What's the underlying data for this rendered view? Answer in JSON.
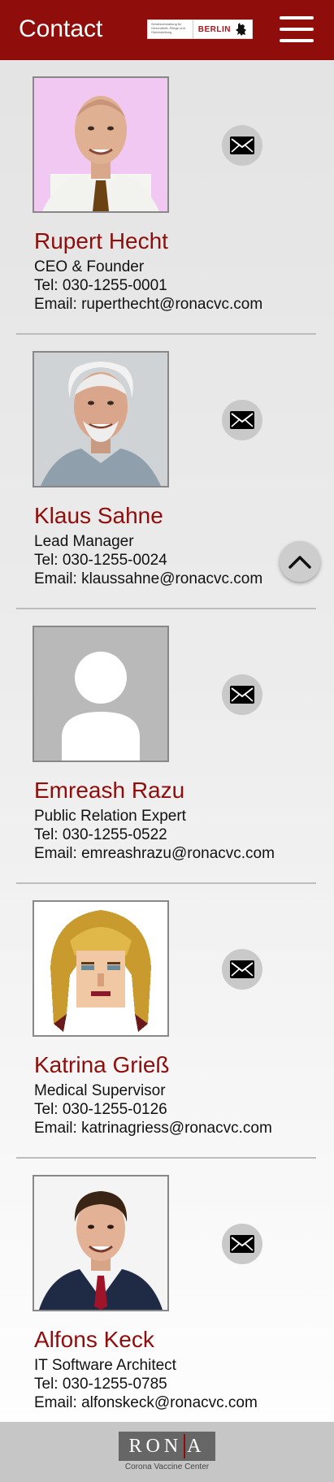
{
  "header": {
    "title": "Contact",
    "logo_small": "Senatsverwaltung für Gesundheit, Pflege und Gleichstellung",
    "logo_word": "BERLIN",
    "bg_color": "#8f0d0a"
  },
  "contacts": [
    {
      "name": "Rupert Hecht",
      "role": "CEO & Founder",
      "tel": "Tel: 030-1255-0001",
      "email": "Email: ruperthecht@ronacvc.com"
    },
    {
      "name": "Klaus Sahne",
      "role": "Lead Manager",
      "tel": "Tel: 030-1255-0024",
      "email": "Email: klaussahne@ronacvc.com"
    },
    {
      "name": "Emreash Razu",
      "role": "Public Relation Expert",
      "tel": "Tel: 030-1255-0522",
      "email": "Email: emreashrazu@ronacvc.com"
    },
    {
      "name": "Katrina Grieß",
      "role": "Medical Supervisor",
      "tel": "Tel: 030-1255-0126",
      "email": "Email: katrinagriess@ronacvc.com"
    },
    {
      "name": "Alfons Keck",
      "role": "IT Software Architect",
      "tel": "Tel: 030-1255-0785",
      "email": "Email: alfonskeck@ronacvc.com"
    }
  ],
  "footer": {
    "logo_left": "RON",
    "logo_right": "A",
    "tagline": "Corona Vaccine Center"
  },
  "icons": {
    "menu": "hamburger-menu-icon",
    "mail": "envelope-icon",
    "scroll_top": "chevron-up-icon"
  }
}
